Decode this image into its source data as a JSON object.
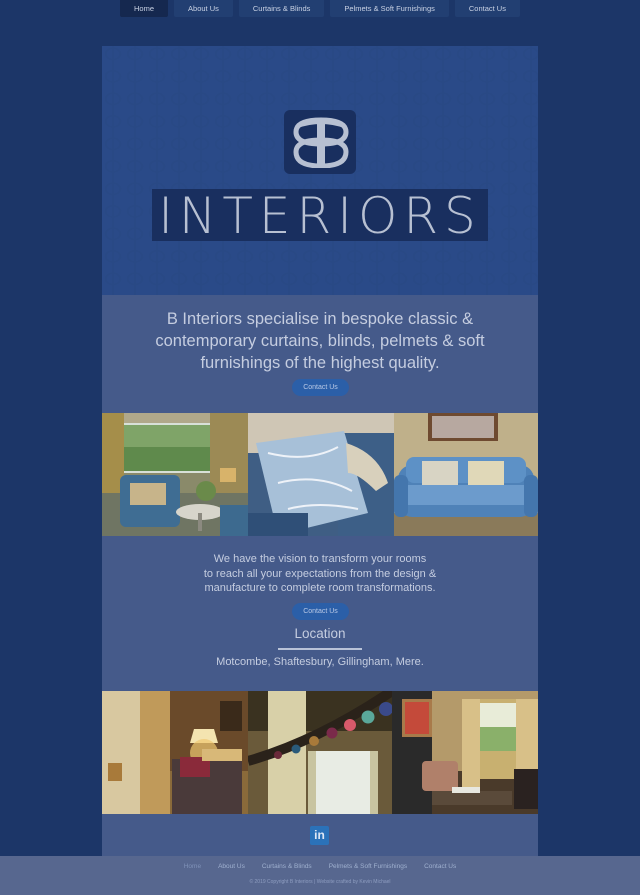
{
  "nav": {
    "items": [
      {
        "label": "Home"
      },
      {
        "label": "About Us"
      },
      {
        "label": "Curtains & Blinds"
      },
      {
        "label": "Pelmets & Soft Furnishings"
      },
      {
        "label": "Contact Us"
      }
    ]
  },
  "hero": {
    "brand": "INTERIORS",
    "logo_icon": "b-monogram-icon"
  },
  "intro": {
    "line1": "B Interiors specialise in bespoke classic &",
    "line2": "contemporary curtains, blinds, pelmets & soft",
    "line3": "furnishings of the highest quality.",
    "button": "Contact Us"
  },
  "vision": {
    "line1": "We have the vision to transform your rooms",
    "line2": "to reach all your expectations from the design &",
    "line3": "manufacture to complete room transformations.",
    "button": "Contact Us"
  },
  "location": {
    "title": "Location",
    "text": "Motcombe, Shaftesbury, Gillingham, Mere."
  },
  "social": {
    "linkedin": "in"
  },
  "footer": {
    "links": [
      {
        "label": "Home"
      },
      {
        "label": "About Us"
      },
      {
        "label": "Curtains & Blinds"
      },
      {
        "label": "Pelmets & Soft Furnishings"
      },
      {
        "label": "Contact Us"
      }
    ],
    "copyright": "© 2019 Copyright B Interiors | Website crafted by Kevin Michael"
  },
  "colors": {
    "page_bg": "#1c3668",
    "container_bg": "#455a8a",
    "button": "#2b5fa8",
    "footer_bg": "#57678f"
  }
}
